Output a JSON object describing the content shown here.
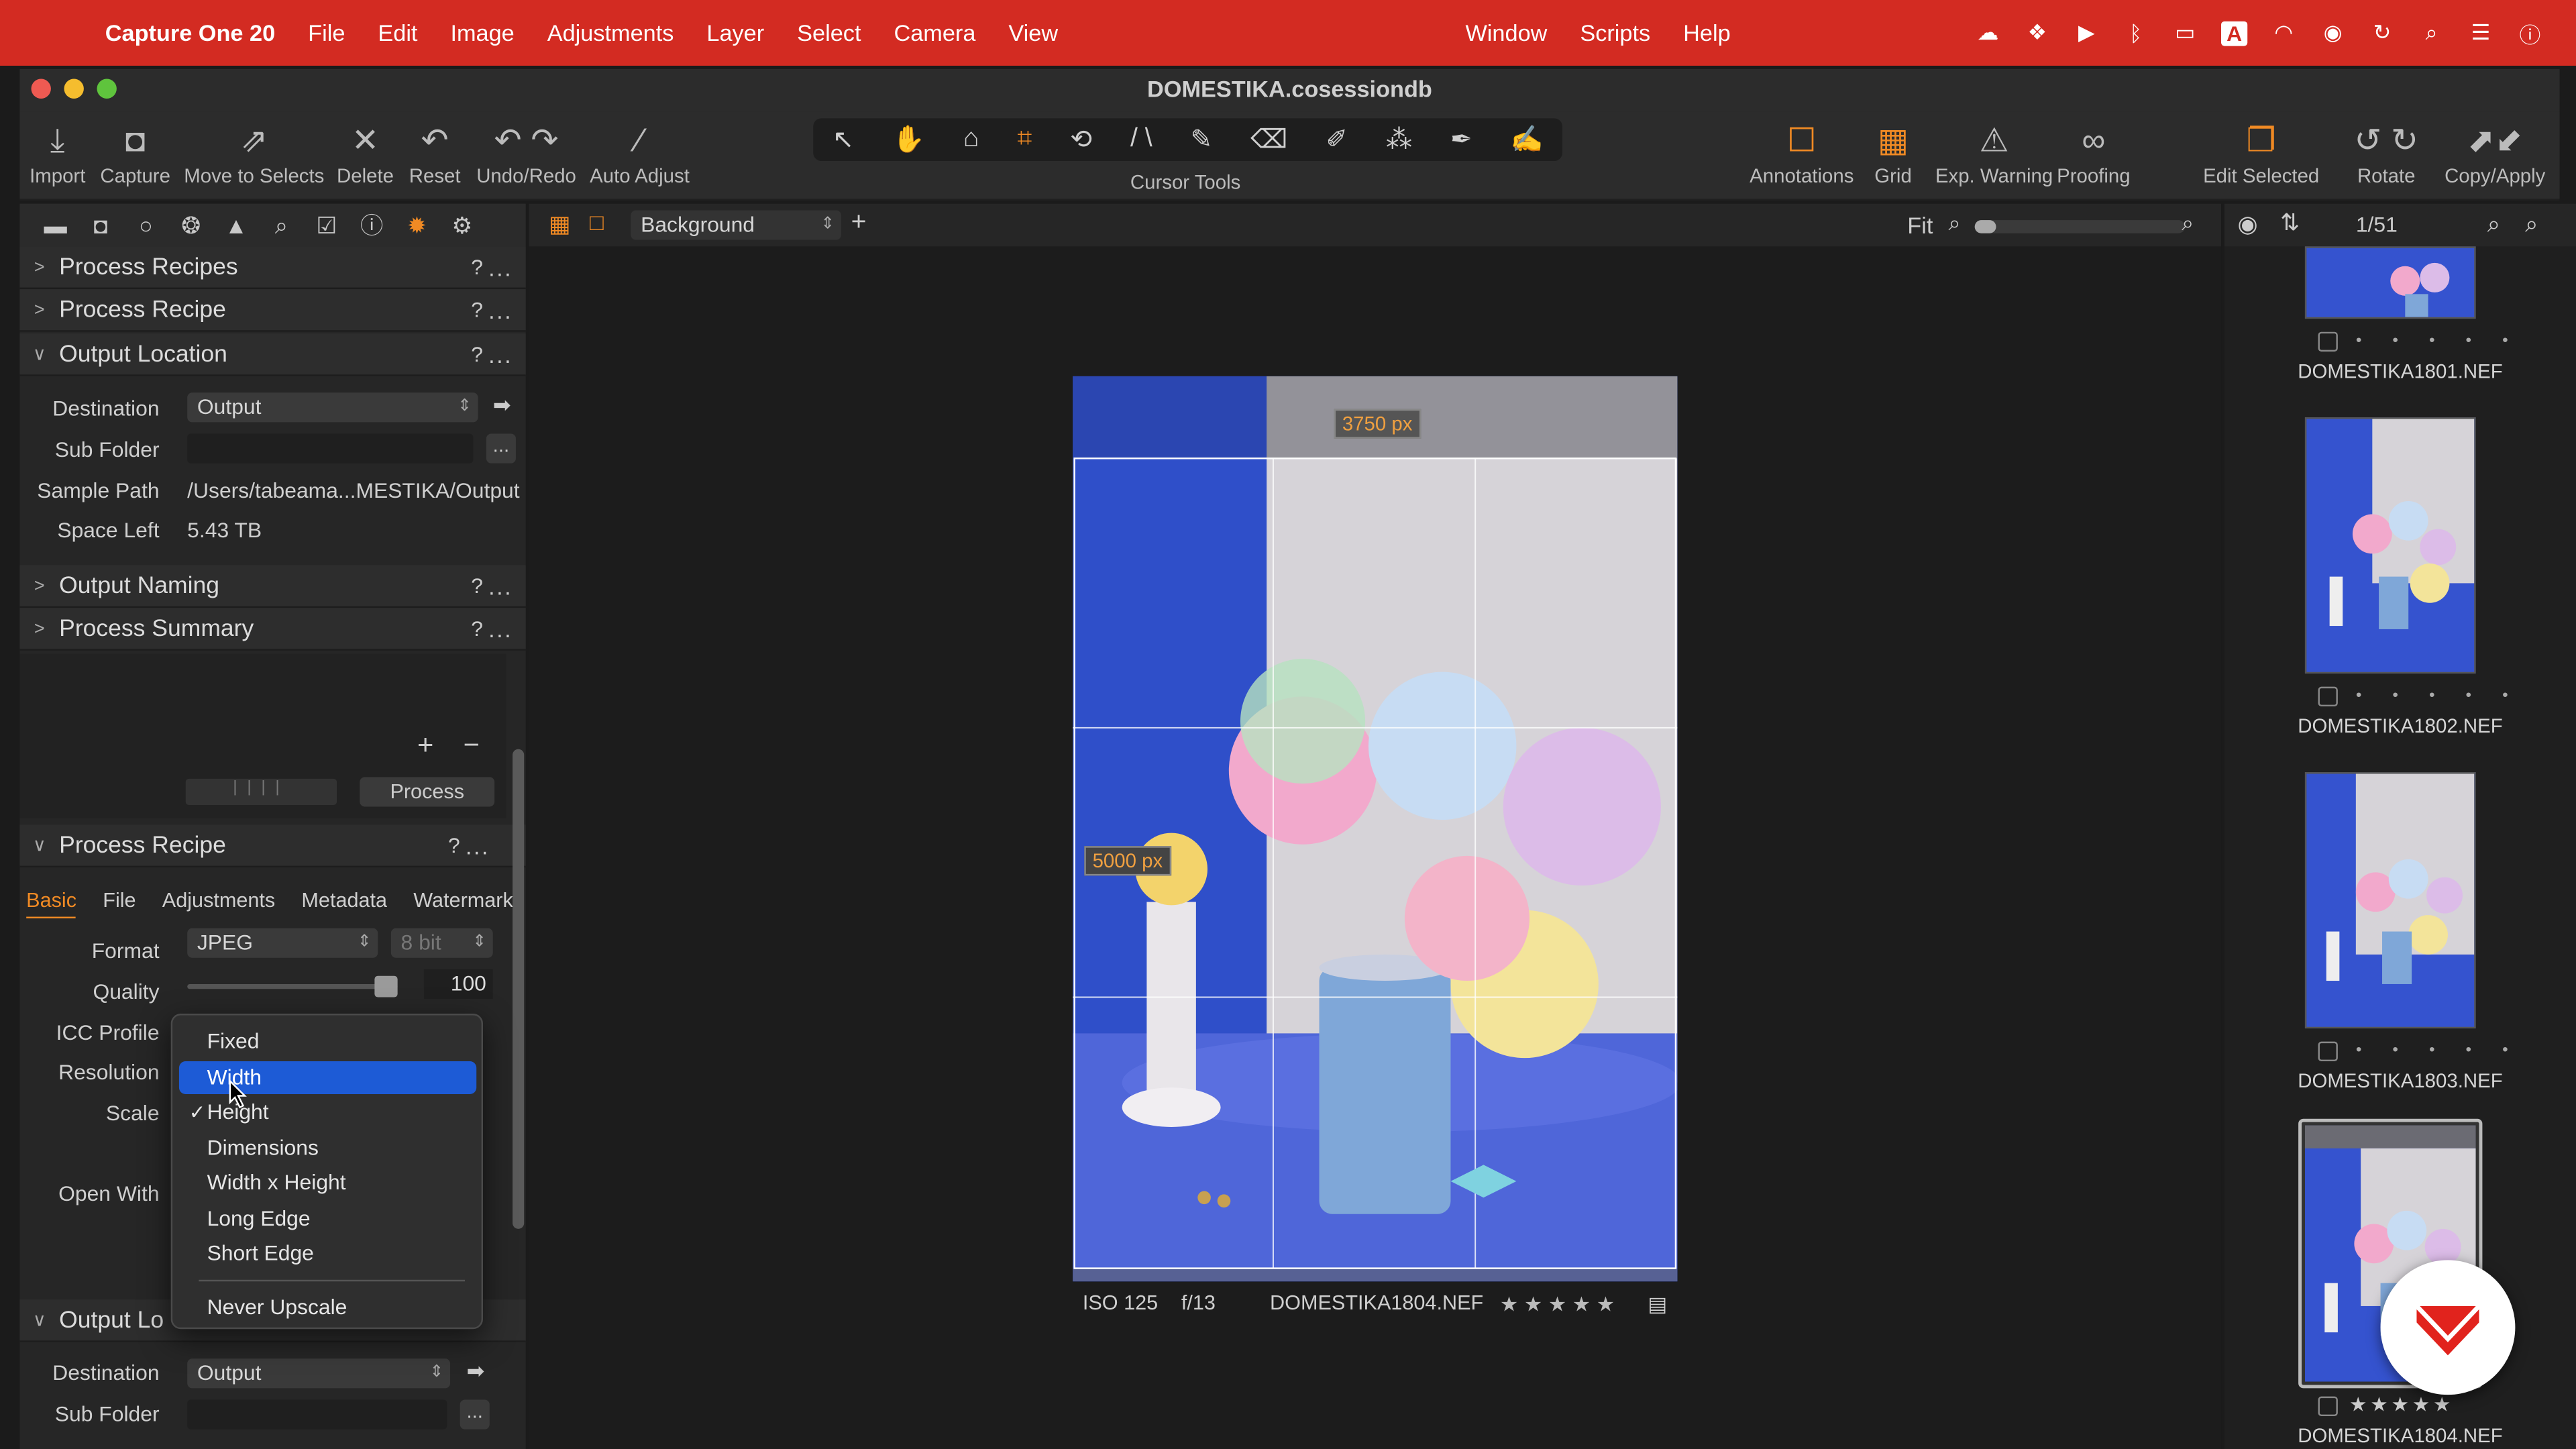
{
  "menubar": {
    "app": "Capture One 20",
    "items": [
      "File",
      "Edit",
      "Image",
      "Adjustments",
      "Layer",
      "Select",
      "Camera",
      "View"
    ],
    "items_right": [
      "Window",
      "Scripts",
      "Help"
    ]
  },
  "window": {
    "title": "DOMESTIKA.cosessiondb"
  },
  "toolbar": {
    "import": "Import",
    "capture": "Capture",
    "move_to_selects": "Move to Selects",
    "delete": "Delete",
    "reset": "Reset",
    "undo_redo": "Undo/Redo",
    "auto_adjust": "Auto Adjust",
    "cursor_tools": "Cursor Tools",
    "annotations": "Annotations",
    "grid": "Grid",
    "exp_warning": "Exp. Warning",
    "proofing": "Proofing",
    "edit_selected": "Edit Selected",
    "rotate": "Rotate",
    "copy_apply": "Copy/Apply"
  },
  "left_panel": {
    "sections_top": [
      {
        "title": "Process Recipes",
        "state": "collapsed"
      },
      {
        "title": "Process Recipe",
        "state": "collapsed"
      },
      {
        "title": "Output Location",
        "state": "expanded"
      }
    ],
    "output_location": {
      "destination_label": "Destination",
      "destination_value": "Output",
      "sub_folder_label": "Sub Folder",
      "sub_folder_btn": "...",
      "sample_path_label": "Sample Path",
      "sample_path_value": "/Users/tabeama...MESTIKA/Output",
      "space_left_label": "Space Left",
      "space_left_value": "5.43 TB"
    },
    "sections_mid": [
      {
        "title": "Output Naming"
      },
      {
        "title": "Process Summary"
      }
    ],
    "process_button": "Process",
    "recipe": {
      "title": "Process Recipe",
      "tabs": [
        "Basic",
        "File",
        "Adjustments",
        "Metadata",
        "Watermark"
      ],
      "active_tab": "Basic",
      "format_label": "Format",
      "format_value": "JPEG",
      "bit_value": "8 bit",
      "quality_label": "Quality",
      "quality_value": "100",
      "quality_level": 1.0,
      "icc_label": "ICC Profile",
      "resolution_label": "Resolution",
      "scale_label": "Scale",
      "open_with_label": "Open With"
    },
    "bottom": {
      "title": "Output Lo",
      "destination_label": "Destination",
      "destination_value": "Output",
      "sub_folder_label": "Sub Folder",
      "sub_folder_btn": "..."
    },
    "help": "?",
    "more": "..."
  },
  "scale_dropdown": {
    "options": [
      "Fixed",
      "Width",
      "Height",
      "Dimensions",
      "Width x Height",
      "Long Edge",
      "Short Edge"
    ],
    "highlighted": "Width",
    "checked": "Height",
    "extra": "Never Upscale",
    "check_mark": "✓"
  },
  "viewer": {
    "background_select": "Background",
    "fit": "Fit",
    "zoom_level": 0.1,
    "crop_width": "3750 px",
    "crop_height": "5000 px",
    "iso": "ISO 125",
    "aperture": "f/13",
    "filename": "DOMESTIKA1804.NEF",
    "stars": "★ ★ ★ ★ ★"
  },
  "browser": {
    "counter": "1/51",
    "thumbs": [
      {
        "name": "DOMESTIKA1801.NEF",
        "stars": "• • • • •"
      },
      {
        "name": "DOMESTIKA1802.NEF",
        "stars": "• • • • •"
      },
      {
        "name": "DOMESTIKA1803.NEF",
        "stars": "• • • • •"
      },
      {
        "name": "DOMESTIKA1804.NEF",
        "stars": "★★★★★"
      }
    ]
  },
  "colors": {
    "menubar": "#d32b22",
    "accent": "#f08a24",
    "highlight": "#1d5bd6"
  }
}
